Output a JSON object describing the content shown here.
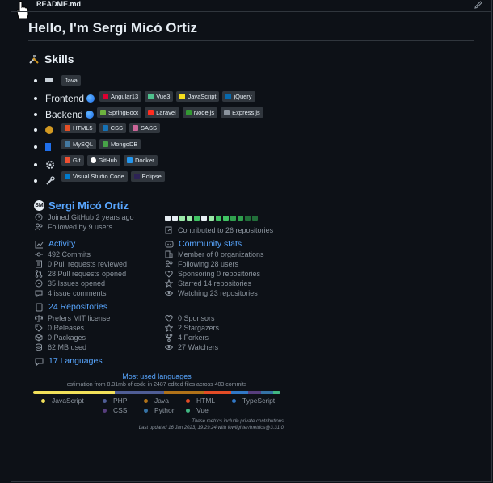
{
  "file": {
    "name": "README.md"
  },
  "readme": {
    "title": "Hello, I'm Sergi Micó Ortiz",
    "skills_heading": "Skills",
    "rows": [
      {
        "label": "",
        "badges": [
          {
            "text": "Java",
            "color": "#ed8b00"
          }
        ]
      },
      {
        "label": "Frontend",
        "badges": [
          {
            "text": "Angular13",
            "color": "#dd0031"
          },
          {
            "text": "Vue3",
            "color": "#4fc08d"
          },
          {
            "text": "JavaScript",
            "color": "#f7df1e"
          },
          {
            "text": "jQuery",
            "color": "#0769ad"
          }
        ]
      },
      {
        "label": "Backend",
        "badges": [
          {
            "text": "SpringBoot",
            "color": "#6db33f"
          },
          {
            "text": "Laravel",
            "color": "#ff2d20"
          },
          {
            "text": "Node.js",
            "color": "#339933"
          },
          {
            "text": "Express.js",
            "color": "#8b949e"
          }
        ]
      },
      {
        "label": "",
        "badges": [
          {
            "text": "HTML5",
            "color": "#e34f26"
          },
          {
            "text": "CSS",
            "color": "#1572b6"
          },
          {
            "text": "SASS",
            "color": "#cc6699"
          }
        ]
      },
      {
        "label": "",
        "badges": [
          {
            "text": "MySQL",
            "color": "#4479a1"
          },
          {
            "text": "MongoDB",
            "color": "#47a248"
          }
        ]
      },
      {
        "label": "",
        "badges": [
          {
            "text": "Git",
            "color": "#f05032"
          },
          {
            "text": "GitHub",
            "color": "#ffffff"
          },
          {
            "text": "Docker",
            "color": "#2496ed"
          }
        ]
      },
      {
        "label": "",
        "badges": [
          {
            "text": "Visual Studio Code",
            "color": "#007acc"
          },
          {
            "text": "Eclipse",
            "color": "#2c2255"
          }
        ]
      }
    ]
  },
  "metrics": {
    "name": "Sergi Micó Ortiz",
    "joined": "Joined GitHub 2 years ago",
    "followed": "Followed by 9 users",
    "contributed": "Contributed to 26 repositories",
    "calendar": [
      0,
      0,
      1,
      1,
      2,
      0,
      1,
      2,
      2,
      3,
      3,
      4,
      4
    ],
    "activity": {
      "title": "Activity",
      "items": [
        "492 Commits",
        "0 Pull requests reviewed",
        "28 Pull requests opened",
        "35 Issues opened",
        "4 issue comments"
      ]
    },
    "community": {
      "title": "Community stats",
      "items": [
        "Member of 0 organizations",
        "Following 28 users",
        "Sponsoring 0 repositories",
        "Starred 14 repositories",
        "Watching 23 repositories"
      ]
    },
    "repos": {
      "title": "24 Repositories",
      "left": [
        "Prefers MIT license",
        "0 Releases",
        "0 Packages",
        "62 MB used"
      ],
      "right": [
        "0 Sponsors",
        "2 Stargazers",
        "4 Forkers",
        "27 Watchers"
      ]
    },
    "languages_link": "17 Languages",
    "languages": {
      "title": "Most used languages",
      "subtitle": "estimation from 8.31mb of code in 2487 edited files across 403 commits",
      "items": [
        {
          "name": "JavaScript",
          "color": "#f1e05a",
          "share": 0.33
        },
        {
          "name": "PHP",
          "color": "#4f5d95",
          "share": 0.2
        },
        {
          "name": "Java",
          "color": "#b07219",
          "share": 0.16
        },
        {
          "name": "HTML",
          "color": "#e34c26",
          "share": 0.11
        },
        {
          "name": "TypeScript",
          "color": "#3178c6",
          "share": 0.07
        },
        {
          "name": "CSS",
          "color": "#563d7c",
          "share": 0.05
        },
        {
          "name": "Python",
          "color": "#3572a5",
          "share": 0.05
        },
        {
          "name": "Vue",
          "color": "#41b883",
          "share": 0.03
        }
      ]
    },
    "footer_note": "These metrics include private contributions",
    "footer_updated": "Last updated 16 Jan 2023, 19:29:24 with lowlighter/metrics@3.31.0"
  }
}
